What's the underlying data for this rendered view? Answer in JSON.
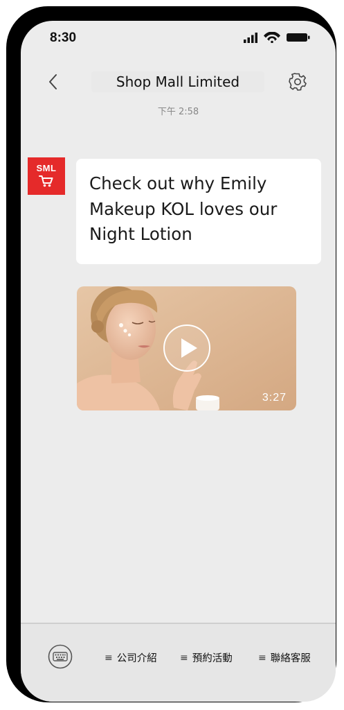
{
  "status_bar": {
    "time": "8:30"
  },
  "header": {
    "title": "Shop Mall Limited"
  },
  "chat": {
    "timestamp": "下午 2:58",
    "sender": {
      "avatar_text": "SML",
      "color": "#e52a2a"
    },
    "message_lines": [
      "Check out why Emily",
      "Makeup KOL loves our",
      "Night Lotion"
    ],
    "video": {
      "duration": "3:27"
    }
  },
  "bottom_menu": {
    "items": [
      {
        "label": "公司介紹"
      },
      {
        "label": "預約活動"
      },
      {
        "label": "聯絡客服"
      }
    ]
  },
  "icons": {
    "back": "chevron-left-icon",
    "settings": "gear-icon",
    "keyboard": "keyboard-icon",
    "menu": "menu-lines-icon",
    "cart": "shopping-cart-icon",
    "play": "play-icon"
  }
}
